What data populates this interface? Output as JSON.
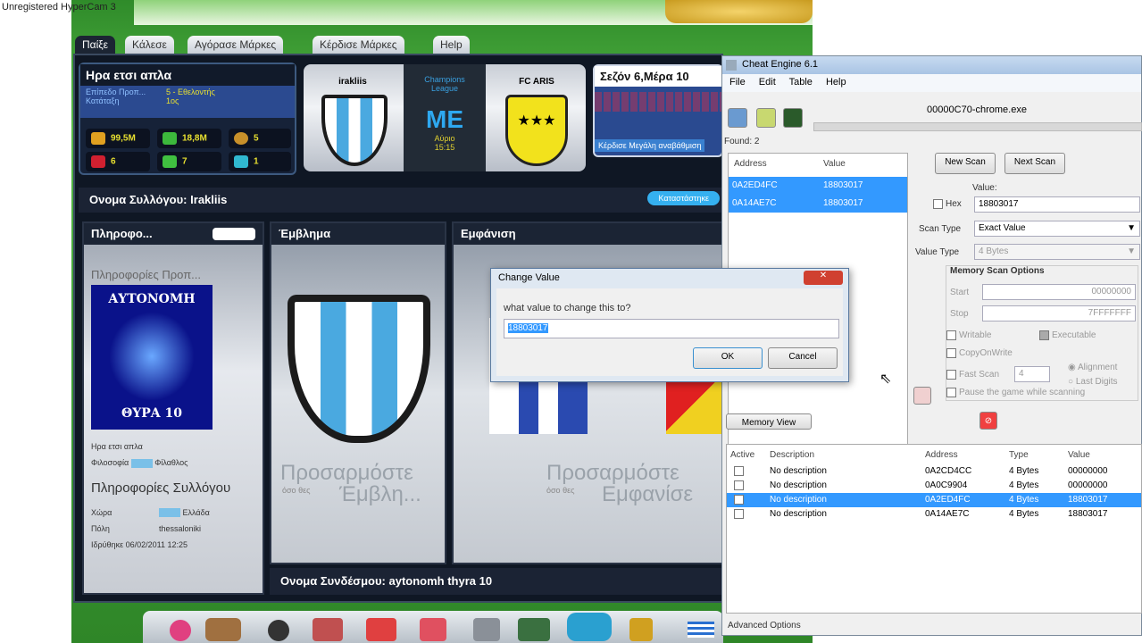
{
  "recorder": "Unregistered HyperCam 3",
  "game": {
    "tabs": [
      "Παίξε",
      "Κάλεσε",
      "Αγόρασε Μάρκες",
      "Κέρδισε Μάρκες",
      "Help"
    ],
    "manager": {
      "name": "Ηρα ετσι απλα",
      "rows": [
        {
          "label": "Επίπεδο Προπ...",
          "value": "5 - Εθελοντής"
        },
        {
          "label": "Κατάταξη",
          "value": "1ος"
        }
      ],
      "stats": [
        {
          "icon": "trophy-icon",
          "value": "99,5M"
        },
        {
          "icon": "money-icon",
          "value": "18,8M"
        },
        {
          "icon": "coin-icon",
          "value": "5"
        },
        {
          "icon": "red-gem-icon",
          "value": "6"
        },
        {
          "icon": "green-gem-icon",
          "value": "7"
        },
        {
          "icon": "blue-gem-icon",
          "value": "1"
        }
      ]
    },
    "match": {
      "home": "irakliis",
      "away": "FC ARIS",
      "competition": "Champions League",
      "score_label": "ΜΕ",
      "venue": "Αύριο",
      "time": "15:15"
    },
    "season": {
      "title": "Σεζόν 6,Μέρα 10",
      "link": "Κέρδισε Μεγάλη αναβάθμιση"
    },
    "club_bar": {
      "label": "Ονομα Συλλόγου:",
      "name": "Irakliis",
      "button": "Καταστάστηκε"
    },
    "info_panel": {
      "title": "Πληροφο...",
      "section1": "Πληροφορίες Προπ...",
      "logo_top": "ΑΥΤΟΝΟΜΗ",
      "logo_bottom": "ΘΥΡΑ 10",
      "manager": "Ηρα ετσι απλα",
      "fan_label": "Φιλοσοφία",
      "fan_value": "Φίλαθλος",
      "section2": "Πληροφορίες Συλλόγου",
      "country_label": "Χώρα",
      "country": "Ελλάδα",
      "city_label": "Πόλη",
      "city": "thessaloniki",
      "founded": "Ιδρύθηκε 06/02/2011 12:25"
    },
    "emblem_panel": {
      "title": "Έμβλημα",
      "cta_small": "όσο θες",
      "cta": "Προσαρμόστε",
      "cta2": "Έμβλη..."
    },
    "appearance_panel": {
      "title": "Εμφάνιση",
      "cta_small": "όσο θες",
      "cta": "Προσαρμόστε",
      "cta2": "Εμφανίσε"
    },
    "association_bar": {
      "label": "Ονομα Συνδέσμου:",
      "name": "aytonomh thyra 10"
    }
  },
  "cheat_engine": {
    "title": "Cheat Engine 6.1",
    "menu": [
      "File",
      "Edit",
      "Table",
      "Help"
    ],
    "process": "00000C70-chrome.exe",
    "found": "Found: 2",
    "results_headers": [
      "Address",
      "Value"
    ],
    "results": [
      {
        "address": "0A2ED4FC",
        "value": "18803017"
      },
      {
        "address": "0A14AE7C",
        "value": "18803017"
      }
    ],
    "new_scan": "New Scan",
    "next_scan": "Next Scan",
    "value_label": "Value:",
    "hex_label": "Hex",
    "value": "18803017",
    "scan_type_label": "Scan Type",
    "scan_type": "Exact Value",
    "value_type_label": "Value Type",
    "value_type": "4 Bytes",
    "mem_options": "Memory Scan Options",
    "start_label": "Start",
    "start": "00000000",
    "stop_label": "Stop",
    "stop": "7FFFFFFF",
    "writable": "Writable",
    "executable": "Executable",
    "copyonwrite": "CopyOnWrite",
    "fastscan": "Fast Scan",
    "fastscan_value": "4",
    "alignment": "Alignment",
    "lastdigits": "Last Digits",
    "pause": "Pause the game while scanning",
    "memory_view": "Memory View",
    "table_headers": [
      "Active",
      "Description",
      "Address",
      "Type",
      "Value"
    ],
    "table": [
      {
        "desc": "No description",
        "address": "0A2CD4CC",
        "type": "4 Bytes",
        "value": "00000000",
        "selected": false
      },
      {
        "desc": "No description",
        "address": "0A0C9904",
        "type": "4 Bytes",
        "value": "00000000",
        "selected": false
      },
      {
        "desc": "No description",
        "address": "0A2ED4FC",
        "type": "4 Bytes",
        "value": "18803017",
        "selected": true
      },
      {
        "desc": "No description",
        "address": "0A14AE7C",
        "type": "4 Bytes",
        "value": "18803017",
        "selected": false
      }
    ],
    "advanced": "Advanced Options"
  },
  "dialog": {
    "title": "Change Value",
    "prompt": "what value to change this to?",
    "value": "18803017",
    "ok": "OK",
    "cancel": "Cancel"
  }
}
